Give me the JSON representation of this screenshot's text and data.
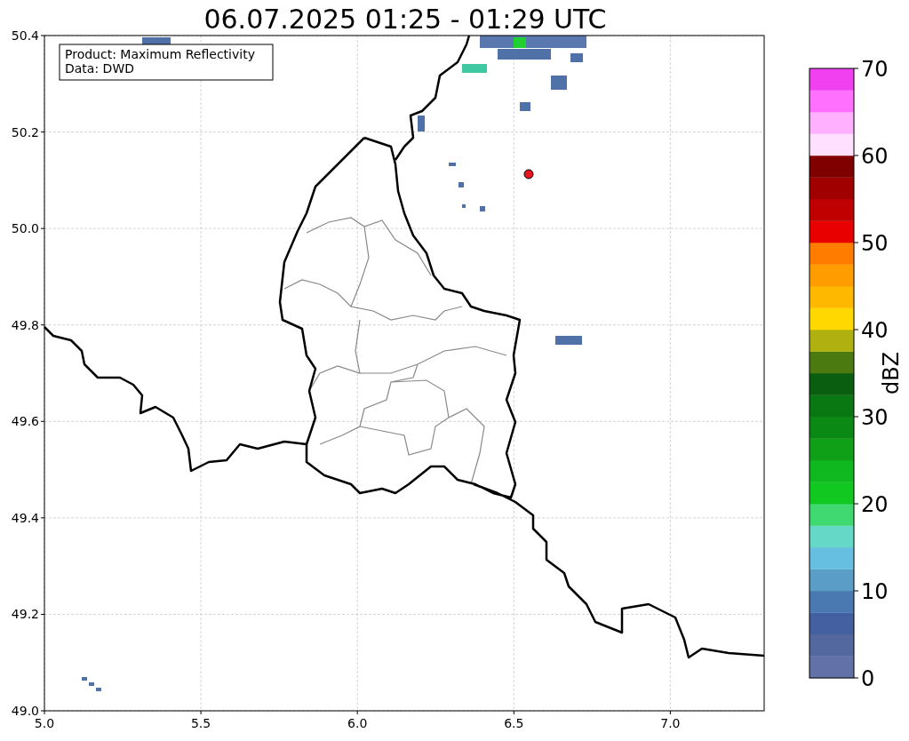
{
  "title": "06.07.2025 01:25 - 01:29 UTC",
  "info_box": {
    "lines": [
      "Product: Maximum Reflectivity",
      "Data: DWD"
    ]
  },
  "map": {
    "x_tick_labels": [
      "5.0",
      "5.5",
      "6.0",
      "6.5",
      "7.0"
    ],
    "y_tick_labels": [
      "50.4",
      "50.2",
      "50.0",
      "49.8",
      "49.6",
      "49.4",
      "49.2",
      "49.0"
    ]
  },
  "colorbar": {
    "label": "dBZ",
    "tick_labels": [
      "70",
      "60",
      "50",
      "40",
      "30",
      "20",
      "10",
      "0"
    ],
    "bands": [
      {
        "color": "#6272a8"
      },
      {
        "color": "#5468a0"
      },
      {
        "color": "#4560a0"
      },
      {
        "color": "#4a78b0"
      },
      {
        "color": "#5a9ec8"
      },
      {
        "color": "#66bfe0"
      },
      {
        "color": "#66d8c8"
      },
      {
        "color": "#40d870"
      },
      {
        "color": "#10c820"
      },
      {
        "color": "#10b820"
      },
      {
        "color": "#10a018"
      },
      {
        "color": "#0a8a14"
      },
      {
        "color": "#0a7812"
      },
      {
        "color": "#0a5e10"
      },
      {
        "color": "#4a7a10"
      },
      {
        "color": "#b0b010"
      },
      {
        "color": "#ffd800"
      },
      {
        "color": "#ffb800"
      },
      {
        "color": "#ff9c00"
      },
      {
        "color": "#ff7c00"
      },
      {
        "color": "#e80000"
      },
      {
        "color": "#c00000"
      },
      {
        "color": "#a00000"
      },
      {
        "color": "#800000"
      },
      {
        "color": "#ffe0ff"
      },
      {
        "color": "#ffb0ff"
      },
      {
        "color": "#ff70ff"
      },
      {
        "color": "#f040f0"
      }
    ]
  }
}
